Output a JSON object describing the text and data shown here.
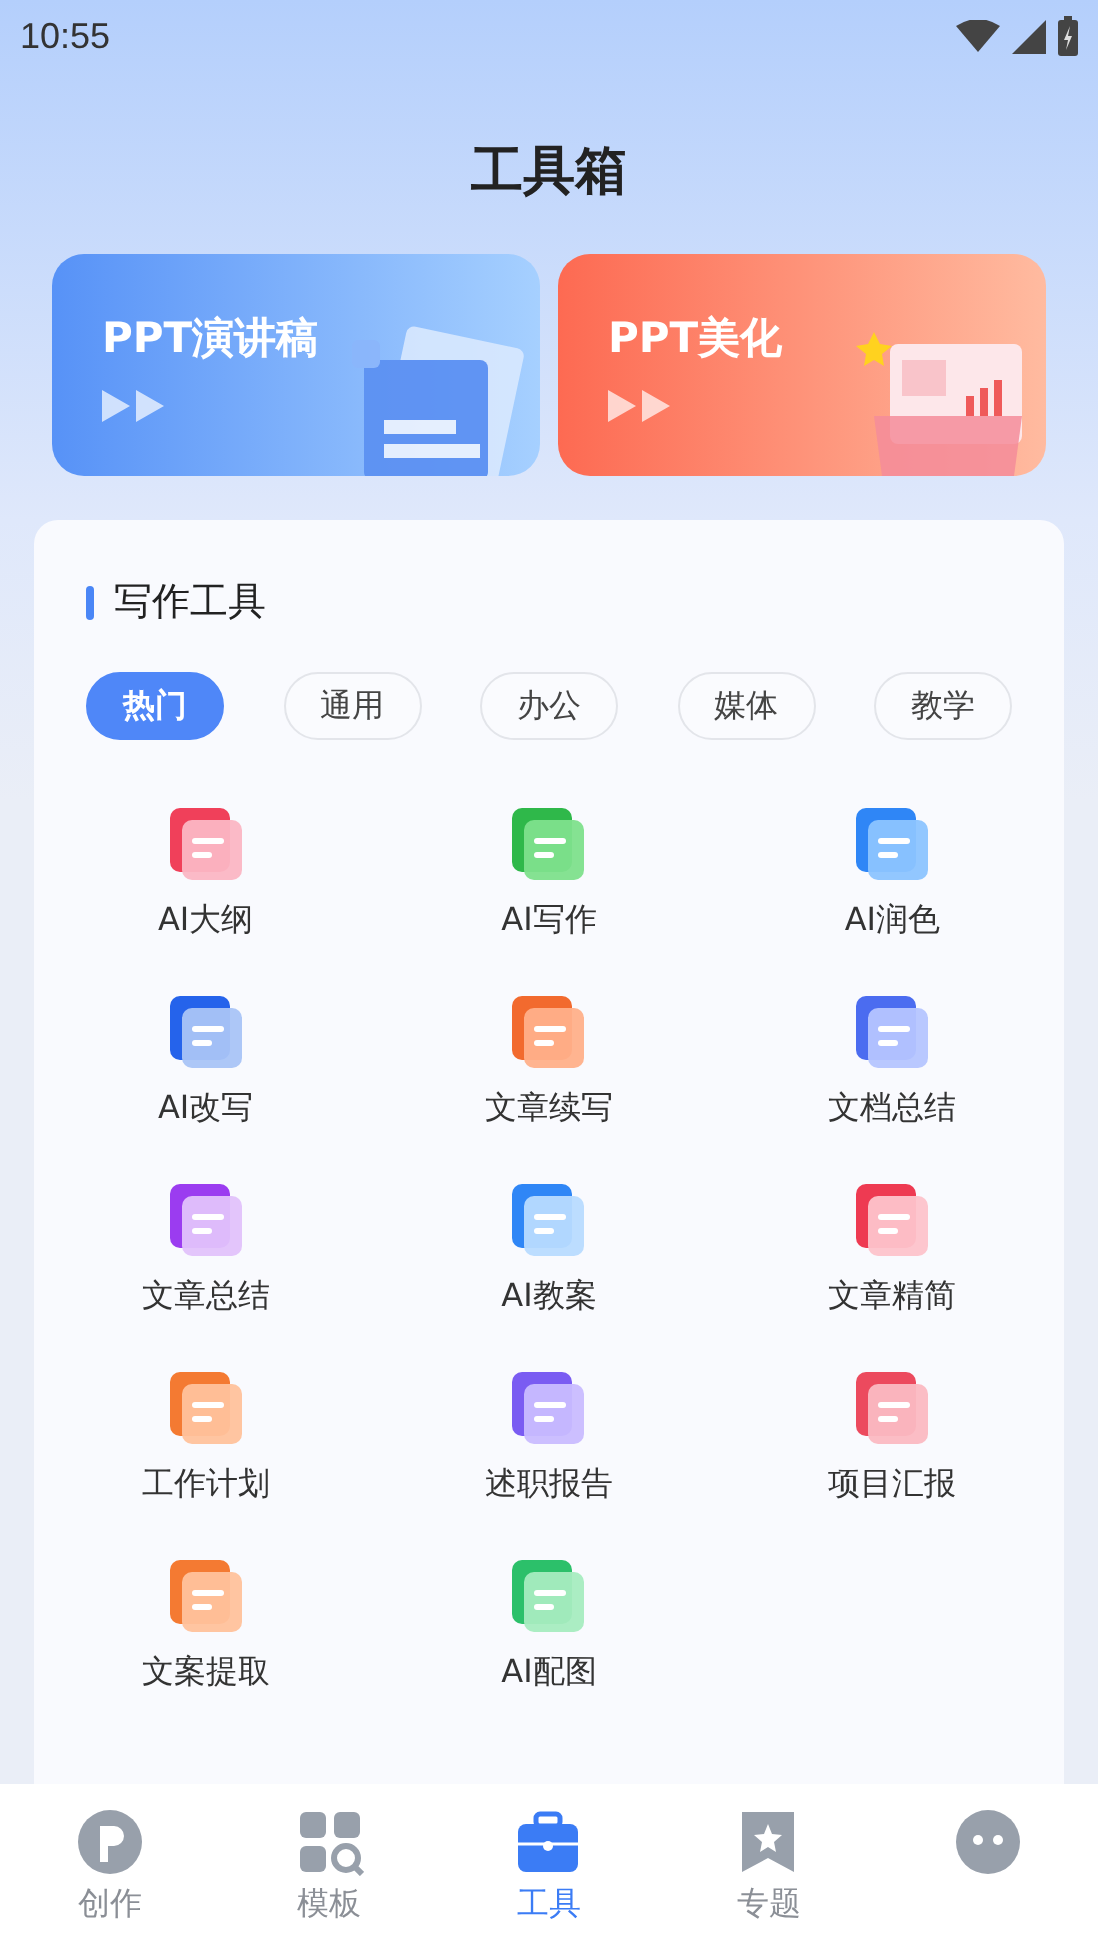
{
  "status_bar": {
    "time": "10:55"
  },
  "header": {
    "title": "工具箱"
  },
  "banners": [
    {
      "title": "PPT演讲稿",
      "kind": "blue"
    },
    {
      "title": "PPT美化",
      "kind": "red"
    }
  ],
  "section": {
    "title": "写作工具",
    "chips": [
      {
        "label": "热门",
        "selected": true
      },
      {
        "label": "通用",
        "selected": false
      },
      {
        "label": "办公",
        "selected": false
      },
      {
        "label": "媒体",
        "selected": false
      },
      {
        "label": "教学",
        "selected": false
      }
    ],
    "tools": [
      {
        "label": "AI大纲"
      },
      {
        "label": "AI写作"
      },
      {
        "label": "AI润色"
      },
      {
        "label": "AI改写"
      },
      {
        "label": "文章续写"
      },
      {
        "label": "文档总结"
      },
      {
        "label": "文章总结"
      },
      {
        "label": "AI教案"
      },
      {
        "label": "文章精简"
      },
      {
        "label": "工作计划"
      },
      {
        "label": "述职报告"
      },
      {
        "label": "项目汇报"
      },
      {
        "label": "文案提取"
      },
      {
        "label": "AI配图"
      }
    ]
  },
  "bottom_nav": [
    {
      "label": "创作",
      "selected": false
    },
    {
      "label": "模板",
      "selected": false
    },
    {
      "label": "工具",
      "selected": true
    },
    {
      "label": "专题",
      "selected": false
    },
    {
      "selected": false
    }
  ]
}
